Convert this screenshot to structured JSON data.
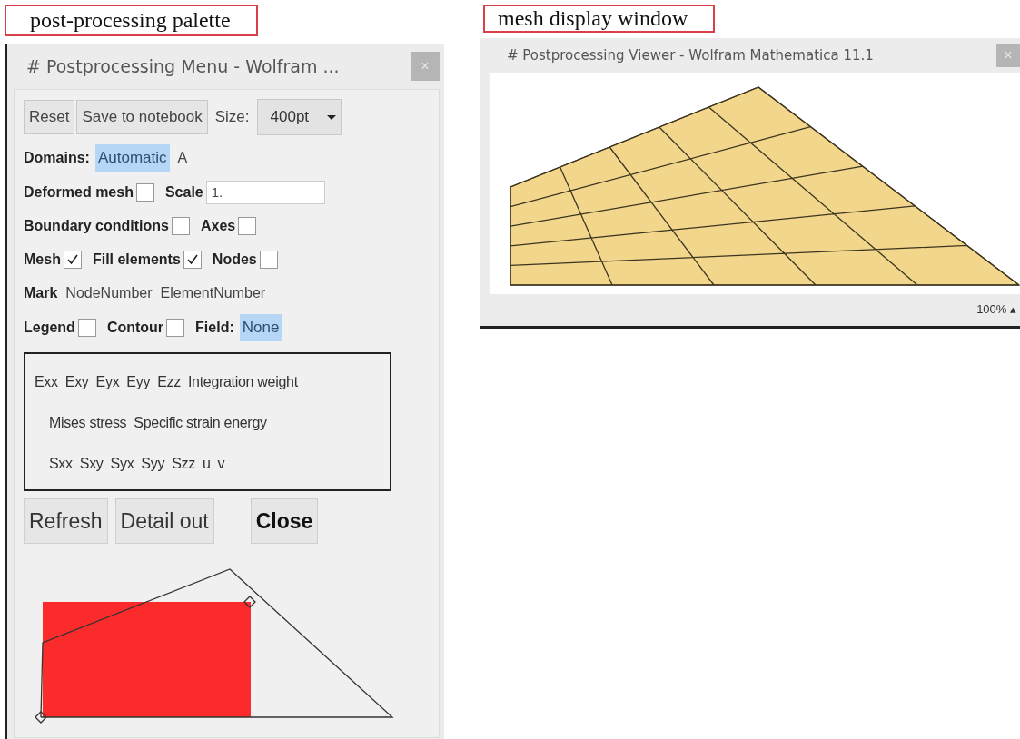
{
  "captions": [
    "post-processing palette",
    "mesh display window"
  ],
  "palette": {
    "title": "# Postprocessing Menu - Wolfram ...",
    "close": "×",
    "toolbar": {
      "buttons": [
        "Reset",
        "Save to notebook"
      ],
      "size_label": "Size:",
      "size_value": "400pt"
    },
    "option_rows": [
      [
        {
          "kind": "label",
          "text": "Domains:"
        },
        {
          "kind": "choice",
          "text": "Automatic",
          "selected": true
        },
        {
          "kind": "link",
          "text": "A"
        }
      ],
      [
        {
          "kind": "checkbox",
          "text": "Deformed mesh",
          "checked": false
        },
        {
          "kind": "field",
          "text": "Scale",
          "value": "1."
        }
      ],
      [
        {
          "kind": "checkbox",
          "text": "Boundary conditions",
          "checked": false
        },
        {
          "kind": "checkbox",
          "text": "Axes",
          "checked": false
        }
      ],
      [
        {
          "kind": "checkbox",
          "text": "Mesh",
          "checked": true
        },
        {
          "kind": "checkbox",
          "text": "Fill elements",
          "checked": true
        },
        {
          "kind": "checkbox",
          "text": "Nodes",
          "checked": false
        }
      ],
      [
        {
          "kind": "label",
          "text": "Mark"
        },
        {
          "kind": "link",
          "text": "NodeNumber"
        },
        {
          "kind": "link",
          "text": "ElementNumber"
        }
      ],
      [
        {
          "kind": "checkbox",
          "text": "Legend",
          "checked": false
        },
        {
          "kind": "checkbox",
          "text": "Contour",
          "checked": false
        },
        {
          "kind": "label",
          "text": "Field:"
        },
        {
          "kind": "choice",
          "text": "None",
          "selected": true
        }
      ]
    ],
    "field_lines": [
      [
        "Exx",
        "Exy",
        "Eyx",
        "Eyy",
        "Ezz",
        "Integration weight"
      ],
      [
        "Mises stress",
        "Specific strain energy"
      ],
      [
        "Sxx",
        "Sxy",
        "Syx",
        "Syy",
        "Szz",
        "u",
        "v"
      ]
    ],
    "actions": [
      {
        "label": "Refresh",
        "default": false
      },
      {
        "label": "Detail out",
        "default": false
      },
      {
        "label": "Close",
        "default": true
      }
    ]
  },
  "viewer": {
    "title": "# Postprocessing Viewer - Wolfram Mathematica 11.1",
    "close": "×",
    "zoom": "100%",
    "zoom_arrow": "▴"
  }
}
